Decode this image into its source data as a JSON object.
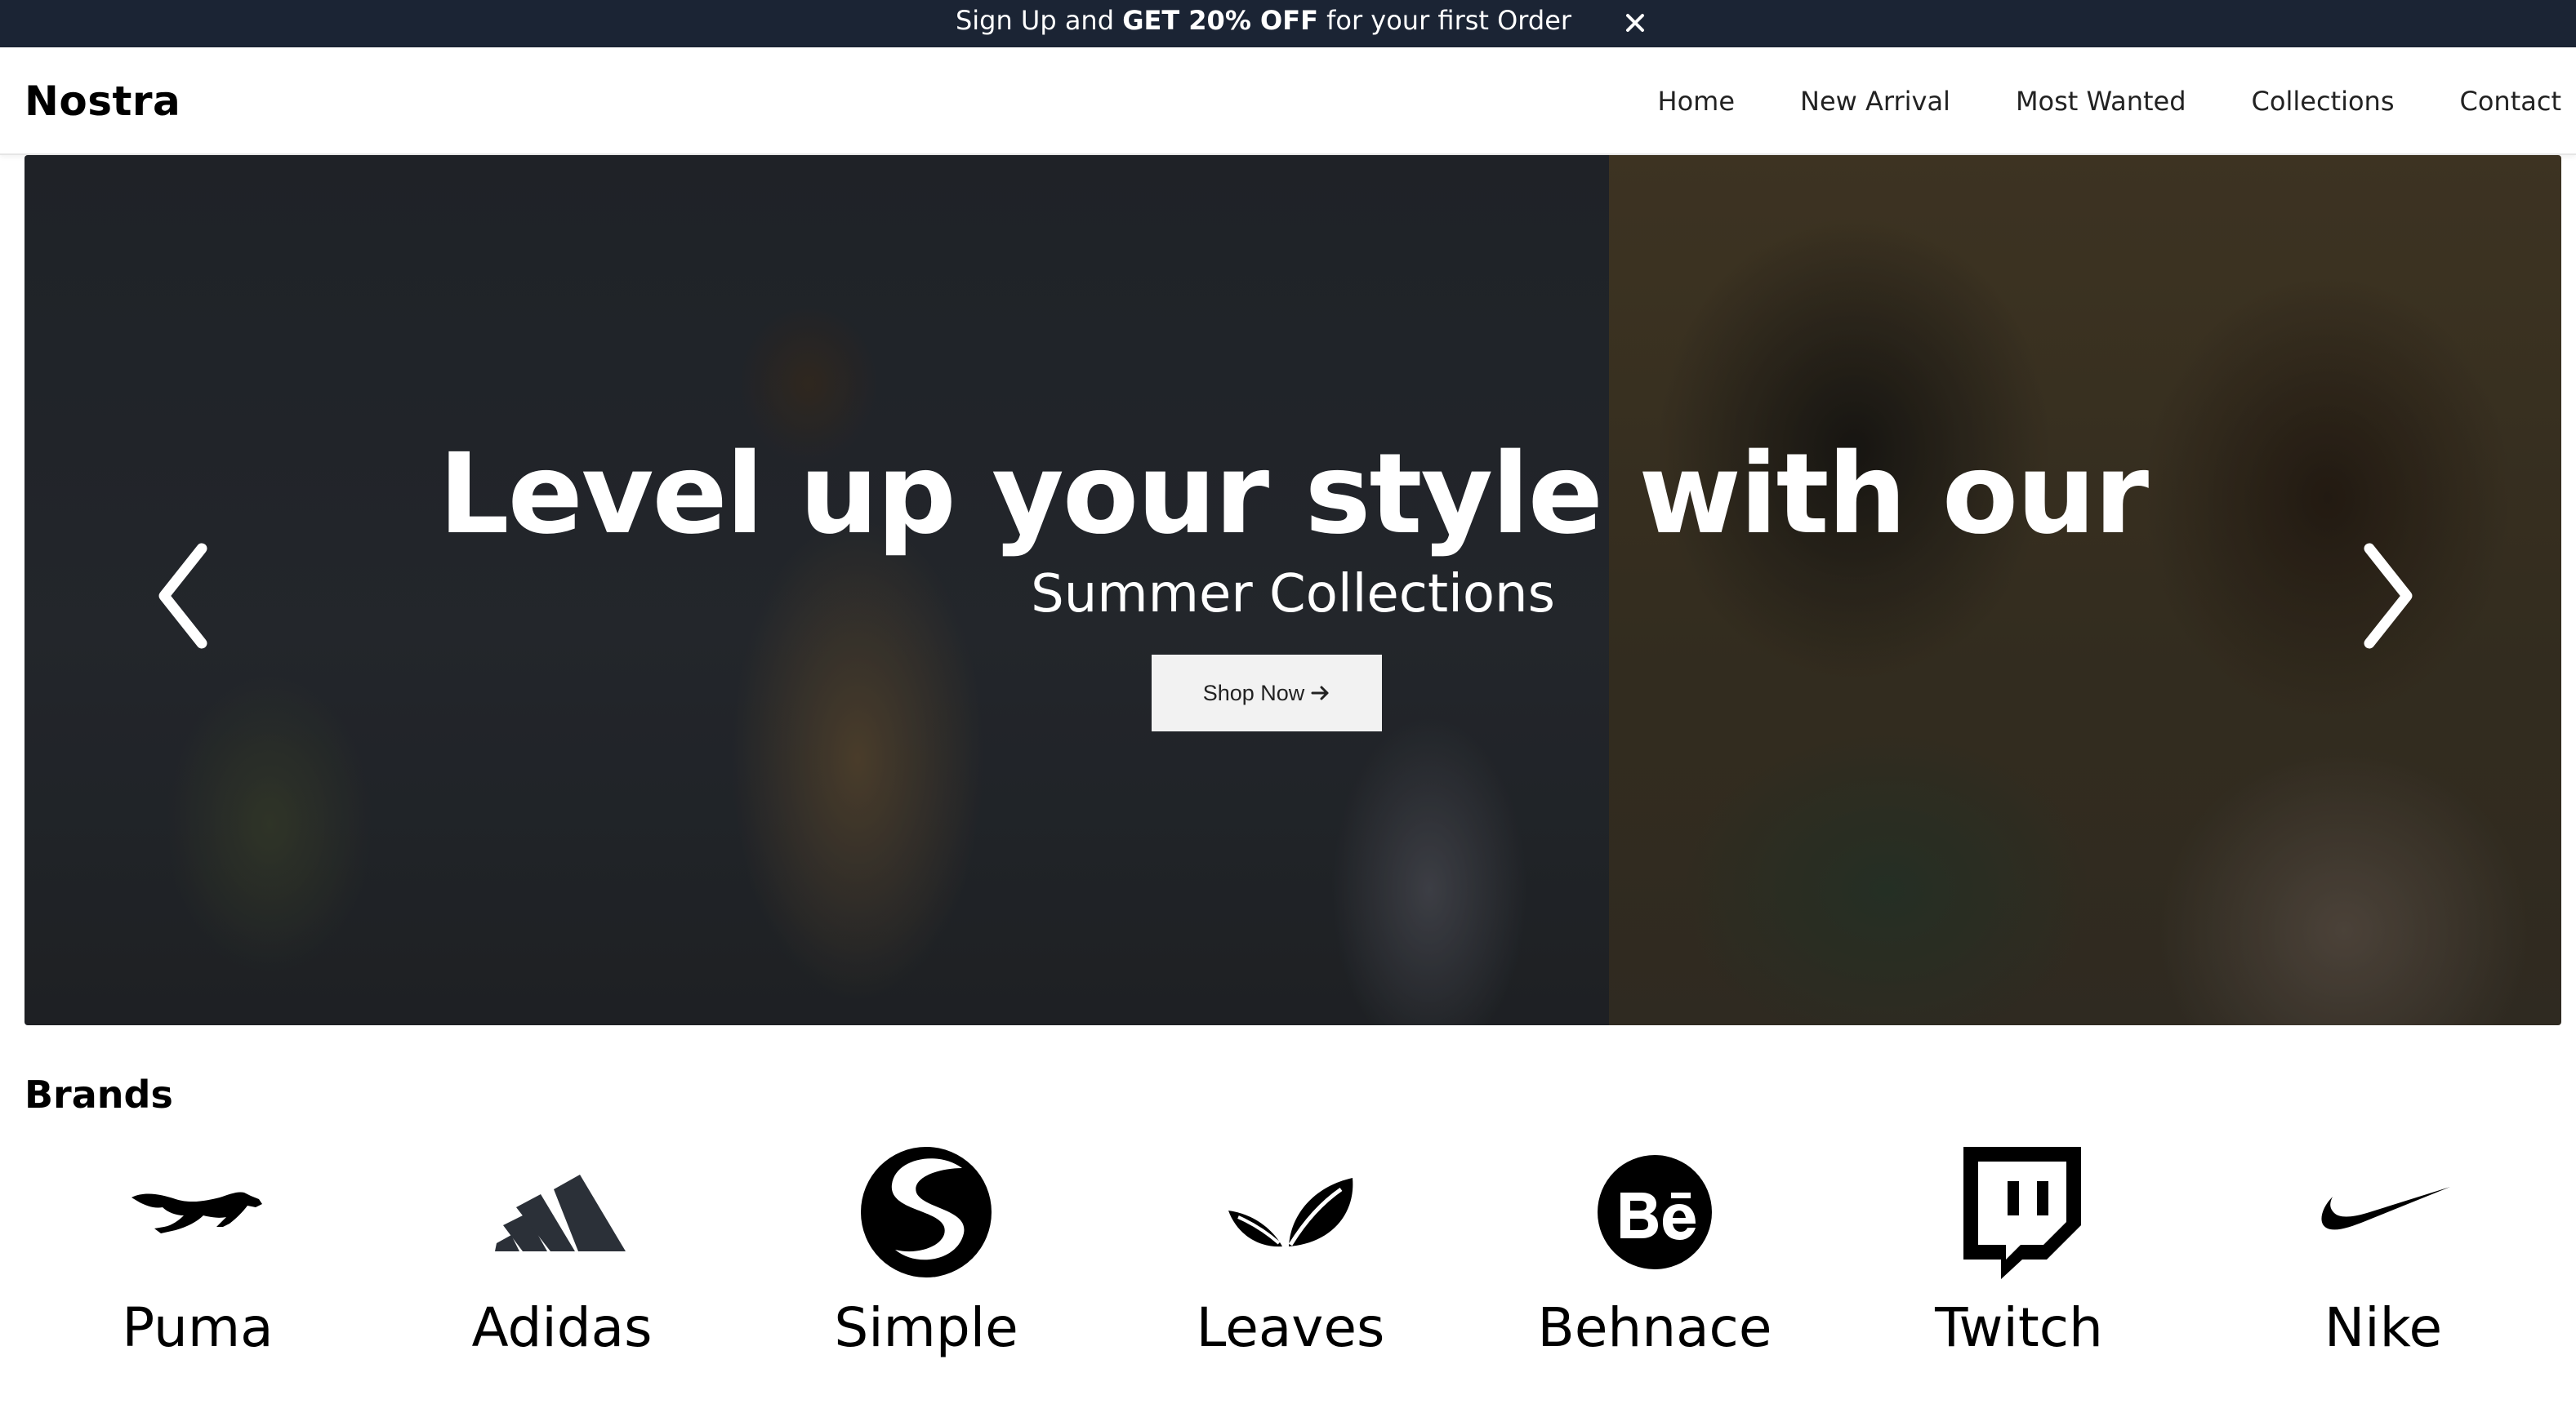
{
  "promo": {
    "text_before": "Sign Up and ",
    "text_bold": "GET 20% OFF",
    "text_after": " for your first Order",
    "close_icon": "close-icon"
  },
  "header": {
    "logo": "Nostra",
    "nav": [
      {
        "label": "Home"
      },
      {
        "label": "New Arrival"
      },
      {
        "label": "Most Wanted"
      },
      {
        "label": "Collections"
      },
      {
        "label": "Contact"
      }
    ]
  },
  "hero": {
    "title": "Level up your style with our",
    "subtitle": "Summer Collections",
    "button_label": "Shop Now",
    "button_icon": "arrow-right-icon",
    "prev_icon": "chevron-left-icon",
    "next_icon": "chevron-right-icon"
  },
  "brands": {
    "title": "Brands",
    "items": [
      {
        "name": "Puma",
        "icon": "puma-icon"
      },
      {
        "name": "Adidas",
        "icon": "adidas-icon"
      },
      {
        "name": "Simple",
        "icon": "simple-icon"
      },
      {
        "name": "Leaves",
        "icon": "leaves-icon"
      },
      {
        "name": "Behnace",
        "icon": "behance-icon"
      },
      {
        "name": "Twitch",
        "icon": "twitch-icon"
      },
      {
        "name": "Nike",
        "icon": "nike-icon"
      }
    ]
  },
  "colors": {
    "promo_bg": "#1b2434",
    "adidas_logo": "#2b3038",
    "button_bg": "#f2f2f2"
  }
}
